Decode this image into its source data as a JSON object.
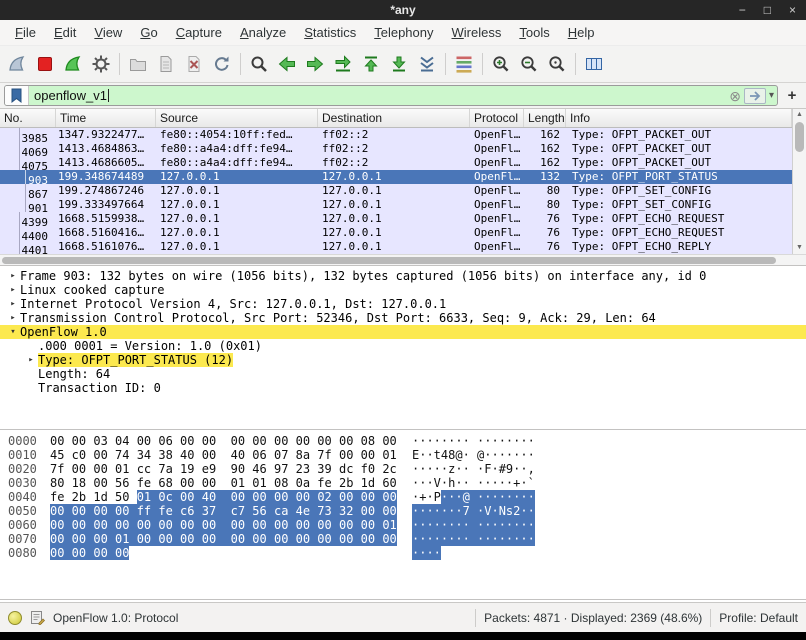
{
  "window": {
    "title": "*any",
    "controls": {
      "minimize": "−",
      "maximize": "□",
      "close": "×"
    }
  },
  "menu": {
    "items": [
      "File",
      "Edit",
      "View",
      "Go",
      "Capture",
      "Analyze",
      "Statistics",
      "Telephony",
      "Wireless",
      "Tools",
      "Help"
    ]
  },
  "toolbar": {
    "icons": [
      "start-capture",
      "stop-capture",
      "restart-capture",
      "capture-options",
      "open-file",
      "save-file",
      "close-file",
      "reload-file",
      "find-packet",
      "go-back",
      "go-forward",
      "go-to-packet",
      "first-packet",
      "last-packet",
      "auto-scroll",
      "colorize-packets",
      "zoom-in",
      "zoom-out",
      "zoom-original",
      "resize-columns"
    ]
  },
  "filter": {
    "value": "openflow_v1",
    "clear_icon": "⊗",
    "dropdown_icon": "▾",
    "add_label": "+"
  },
  "packet_list": {
    "columns": {
      "no": "No.",
      "time": "Time",
      "source": "Source",
      "destination": "Destination",
      "protocol": "Protocol",
      "length": "Length",
      "info": "Info"
    },
    "rows": [
      {
        "no": "3985",
        "time": "1347.9322477…",
        "source": "fe80::4054:10ff:fed…",
        "destination": "ff02::2",
        "protocol": "OpenFl…",
        "length": "162",
        "info": "Type: OFPT_PACKET_OUT",
        "selected": false
      },
      {
        "no": "4069",
        "time": "1413.4684863…",
        "source": "fe80::a4a4:dff:fe94…",
        "destination": "ff02::2",
        "protocol": "OpenFl…",
        "length": "162",
        "info": "Type: OFPT_PACKET_OUT",
        "selected": false
      },
      {
        "no": "4075",
        "time": "1413.4686605…",
        "source": "fe80::a4a4:dff:fe94…",
        "destination": "ff02::2",
        "protocol": "OpenFl…",
        "length": "162",
        "info": "Type: OFPT_PACKET_OUT",
        "selected": false
      },
      {
        "no": "903",
        "time": "199.348674489",
        "source": "127.0.0.1",
        "destination": "127.0.0.1",
        "protocol": "OpenFl…",
        "length": "132",
        "info": "Type: OFPT_PORT_STATUS",
        "selected": true
      },
      {
        "no": "867",
        "time": "199.274867246",
        "source": "127.0.0.1",
        "destination": "127.0.0.1",
        "protocol": "OpenFl…",
        "length": "80",
        "info": "Type: OFPT_SET_CONFIG",
        "selected": false
      },
      {
        "no": "901",
        "time": "199.333497664",
        "source": "127.0.0.1",
        "destination": "127.0.0.1",
        "protocol": "OpenFl…",
        "length": "80",
        "info": "Type: OFPT_SET_CONFIG",
        "selected": false
      },
      {
        "no": "4399",
        "time": "1668.5159938…",
        "source": "127.0.0.1",
        "destination": "127.0.0.1",
        "protocol": "OpenFl…",
        "length": "76",
        "info": "Type: OFPT_ECHO_REQUEST",
        "selected": false
      },
      {
        "no": "4400",
        "time": "1668.5160416…",
        "source": "127.0.0.1",
        "destination": "127.0.0.1",
        "protocol": "OpenFl…",
        "length": "76",
        "info": "Type: OFPT_ECHO_REQUEST",
        "selected": false
      },
      {
        "no": "4401",
        "time": "1668.5161076…",
        "source": "127.0.0.1",
        "destination": "127.0.0.1",
        "protocol": "OpenFl…",
        "length": "76",
        "info": "Type: OFPT_ECHO_REPLY",
        "selected": false
      }
    ]
  },
  "details": {
    "lines": [
      {
        "text": "Frame 903: 132 bytes on wire (1056 bits), 132 bytes captured (1056 bits) on interface any, id 0",
        "expander": "collapsed",
        "indent": 0,
        "highlight": "none"
      },
      {
        "text": "Linux cooked capture",
        "expander": "collapsed",
        "indent": 0,
        "highlight": "none"
      },
      {
        "text": "Internet Protocol Version 4, Src: 127.0.0.1, Dst: 127.0.0.1",
        "expander": "collapsed",
        "indent": 0,
        "highlight": "none"
      },
      {
        "text": "Transmission Control Protocol, Src Port: 52346, Dst Port: 6633, Seq: 9, Ack: 29, Len: 64",
        "expander": "collapsed",
        "indent": 0,
        "highlight": "none"
      },
      {
        "text": "OpenFlow 1.0",
        "expander": "expanded",
        "indent": 0,
        "highlight": "row"
      },
      {
        "text": ".000 0001 = Version: 1.0 (0x01)",
        "expander": "none",
        "indent": 1,
        "highlight": "none"
      },
      {
        "text": "Type: OFPT_PORT_STATUS (12)",
        "expander": "collapsed",
        "indent": 1,
        "highlight": "text"
      },
      {
        "text": "Length: 64",
        "expander": "none",
        "indent": 1,
        "highlight": "none"
      },
      {
        "text": "Transaction ID: 0",
        "expander": "none",
        "indent": 1,
        "highlight": "none"
      }
    ]
  },
  "hex": {
    "rows": [
      {
        "offset": "0000",
        "hex_pre": "00 00 03 04 00 06 00 00  00 00 00 00 00 00 08 00",
        "hex_sel": "",
        "ascii_pre": "········ ········",
        "ascii_sel": ""
      },
      {
        "offset": "0010",
        "hex_pre": "45 c0 00 74 34 38 40 00  40 06 07 8a 7f 00 00 01",
        "hex_sel": "",
        "ascii_pre": "E··t48@· @·······",
        "ascii_sel": ""
      },
      {
        "offset": "0020",
        "hex_pre": "7f 00 00 01 cc 7a 19 e9  90 46 97 23 39 dc f0 2c",
        "hex_sel": "",
        "ascii_pre": "·····z·· ·F·#9··,",
        "ascii_sel": ""
      },
      {
        "offset": "0030",
        "hex_pre": "80 18 00 56 fe 68 00 00  01 01 08 0a fe 2b 1d 60",
        "hex_sel": "",
        "ascii_pre": "···V·h·· ·····+·`",
        "ascii_sel": ""
      },
      {
        "offset": "0040",
        "hex_pre": "fe 2b 1d 50 ",
        "hex_sel": "01 0c 00 40  00 00 00 00 02 00 00 00",
        "ascii_pre": "·+·P",
        "ascii_sel": "···@ ········"
      },
      {
        "offset": "0050",
        "hex_pre": "",
        "hex_sel": "00 00 00 00 ff fe c6 37  c7 56 ca 4e 73 32 00 00",
        "ascii_pre": "",
        "ascii_sel": "·······7 ·V·Ns2··"
      },
      {
        "offset": "0060",
        "hex_pre": "",
        "hex_sel": "00 00 00 00 00 00 00 00  00 00 00 00 00 00 00 01",
        "ascii_pre": "",
        "ascii_sel": "········ ········"
      },
      {
        "offset": "0070",
        "hex_pre": "",
        "hex_sel": "00 00 00 01 00 00 00 00  00 00 00 00 00 00 00 00",
        "ascii_pre": "",
        "ascii_sel": "········ ········"
      },
      {
        "offset": "0080",
        "hex_pre": "",
        "hex_sel": "00 00 00 00",
        "ascii_pre": "",
        "ascii_sel": "····"
      }
    ]
  },
  "status": {
    "field_info": "OpenFlow 1.0: Protocol",
    "packets": "Packets: 4871 · Displayed: 2369 (48.6%)",
    "profile": "Profile: Default"
  },
  "colors": {
    "selection_blue": "#4a76b8",
    "openflow_row_lavender": "#e7e6ff",
    "filter_match_yellow": "#fce94f",
    "filter_valid_green": "#cdf7cd",
    "titlebar": "#262626"
  }
}
